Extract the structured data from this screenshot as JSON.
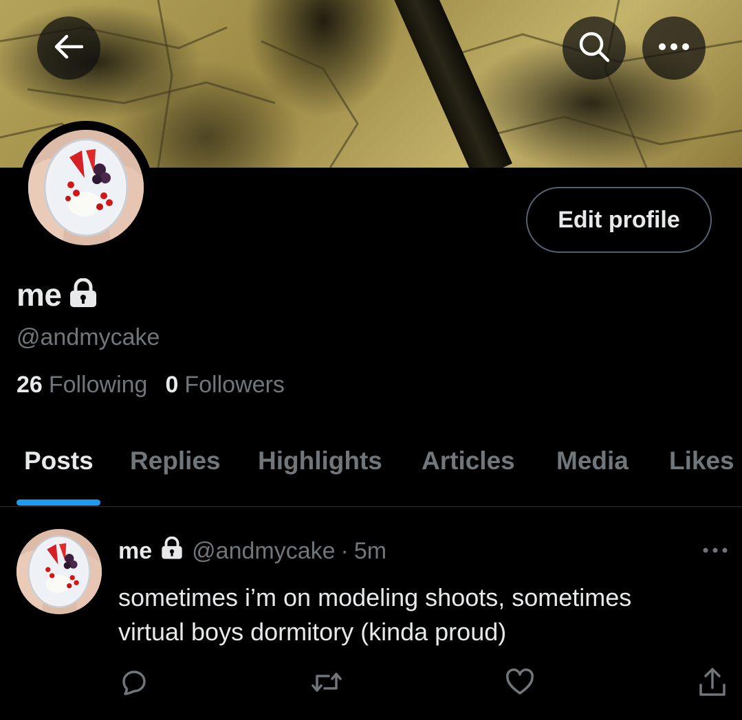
{
  "profile": {
    "name": "me",
    "handle": "@andmycake",
    "following_count": "26",
    "following_label": "Following",
    "followers_count": "0",
    "followers_label": "Followers",
    "edit_button_label": "Edit profile"
  },
  "tabs": [
    {
      "label": "Posts",
      "active": true
    },
    {
      "label": "Replies",
      "active": false
    },
    {
      "label": "Highlights",
      "active": false
    },
    {
      "label": "Articles",
      "active": false
    },
    {
      "label": "Media",
      "active": false
    },
    {
      "label": "Likes",
      "active": false
    }
  ],
  "post": {
    "author_name": "me",
    "author_handle": "@andmycake",
    "separator": "·",
    "time": "5m",
    "text_lines": [
      "sometimes i’m on modeling shoots, sometimes",
      "virtual boys dormitory (kinda proud)"
    ]
  },
  "icons": {
    "back": "arrow-left-icon",
    "search": "search-icon",
    "more": "more-horizontal-icon",
    "lock": "lock-icon",
    "reply": "reply-icon",
    "retweet": "retweet-icon",
    "like": "heart-icon",
    "share": "share-icon"
  },
  "colors": {
    "background": "#000000",
    "text_primary": "#e7e9ea",
    "text_secondary": "#71767b",
    "accent": "#1d9bf0",
    "border": "#2f3336"
  }
}
